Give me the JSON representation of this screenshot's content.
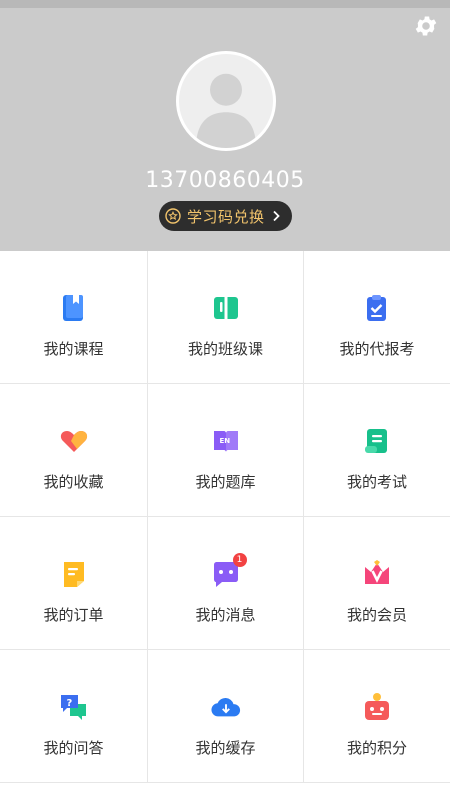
{
  "profile": {
    "phone": "13700860405",
    "redeem_label": "学习码兑换"
  },
  "colors": {
    "header_bg": "#cbcbcb",
    "redeem_bg": "#2d2d2d",
    "redeem_text": "#f2c46c",
    "badge": "#f24242"
  },
  "menu": [
    {
      "label": "我的课程",
      "icon": "book-icon"
    },
    {
      "label": "我的班级课",
      "icon": "open-book-icon"
    },
    {
      "label": "我的代报考",
      "icon": "clipboard-check-icon"
    },
    {
      "label": "我的收藏",
      "icon": "heart-icon"
    },
    {
      "label": "我的题库",
      "icon": "en-book-icon"
    },
    {
      "label": "我的考试",
      "icon": "scroll-icon"
    },
    {
      "label": "我的订单",
      "icon": "note-icon"
    },
    {
      "label": "我的消息",
      "icon": "message-icon",
      "badge": "1"
    },
    {
      "label": "我的会员",
      "icon": "crown-v-icon"
    },
    {
      "label": "我的问答",
      "icon": "question-chat-icon"
    },
    {
      "label": "我的缓存",
      "icon": "cloud-download-icon"
    },
    {
      "label": "我的积分",
      "icon": "points-icon"
    }
  ]
}
